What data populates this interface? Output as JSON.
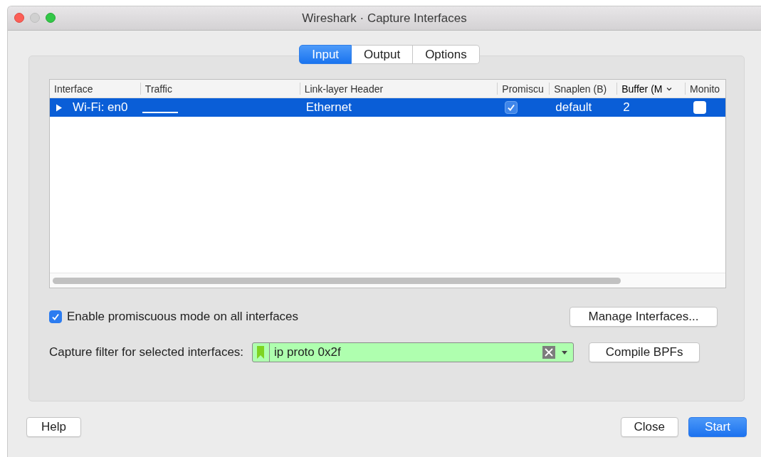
{
  "window": {
    "title": "Wireshark · Capture Interfaces"
  },
  "tabs": [
    {
      "label": "Input",
      "selected": true
    },
    {
      "label": "Output",
      "selected": false
    },
    {
      "label": "Options",
      "selected": false
    }
  ],
  "table": {
    "columns": [
      {
        "label": "Interface",
        "sorted": false
      },
      {
        "label": "Traffic",
        "sorted": false
      },
      {
        "label": "Link-layer Header",
        "sorted": false
      },
      {
        "label": "Promiscu",
        "sorted": false
      },
      {
        "label": "Snaplen (B)",
        "sorted": false
      },
      {
        "label": "Buffer (M",
        "sorted": true
      },
      {
        "label": "Monito",
        "sorted": false
      }
    ],
    "rows": [
      {
        "selected": true,
        "expanded": false,
        "interface": "Wi-Fi: en0",
        "link_layer": "Ethernet",
        "promiscuous": true,
        "snaplen": "default",
        "buffer": "2",
        "monitor": false
      }
    ]
  },
  "promiscuous_all": {
    "label": "Enable promiscuous mode on all interfaces",
    "checked": true
  },
  "manage_button": "Manage Interfaces...",
  "capture_filter": {
    "label": "Capture filter for selected interfaces:",
    "value": "ip proto 0x2f",
    "valid": true
  },
  "compile_button": "Compile BPFs",
  "buttons": [
    {
      "label": "Help",
      "default": false
    },
    {
      "label": "Close",
      "default": false
    },
    {
      "label": "Start",
      "default": true
    }
  ]
}
